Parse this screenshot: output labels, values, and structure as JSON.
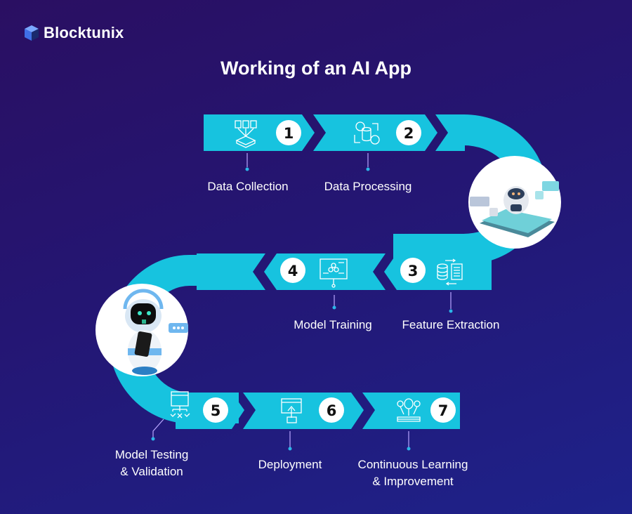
{
  "brand": {
    "name": "Blocktunix",
    "logo_icon": "cube-icon"
  },
  "title": "Working of an AI App",
  "colors": {
    "ribbon": "#17c3df",
    "background_top": "#2a0f62",
    "background_bottom": "#1e228a",
    "badge": "#ffffff",
    "connector": "#b9a6ff",
    "dot": "#2bb6e8"
  },
  "steps": [
    {
      "number": "1",
      "label": "Data Collection",
      "icon": "data-collection-icon"
    },
    {
      "number": "2",
      "label": "Data Processing",
      "icon": "data-processing-icon"
    },
    {
      "number": "3",
      "label": "Feature Extraction",
      "icon": "feature-extraction-icon"
    },
    {
      "number": "4",
      "label": "Model Training",
      "icon": "model-training-icon"
    },
    {
      "number": "5",
      "label_line1": "Model Testing",
      "label_line2": "& Validation",
      "icon": "model-testing-icon"
    },
    {
      "number": "6",
      "label": "Deployment",
      "icon": "deployment-icon"
    },
    {
      "number": "7",
      "label_line1": "Continuous Learning",
      "label_line2": "& Improvement",
      "icon": "continuous-learning-icon"
    }
  ],
  "illustrations": [
    {
      "name": "chatbot-on-tablet-illustration"
    },
    {
      "name": "robot-with-phone-illustration"
    }
  ]
}
